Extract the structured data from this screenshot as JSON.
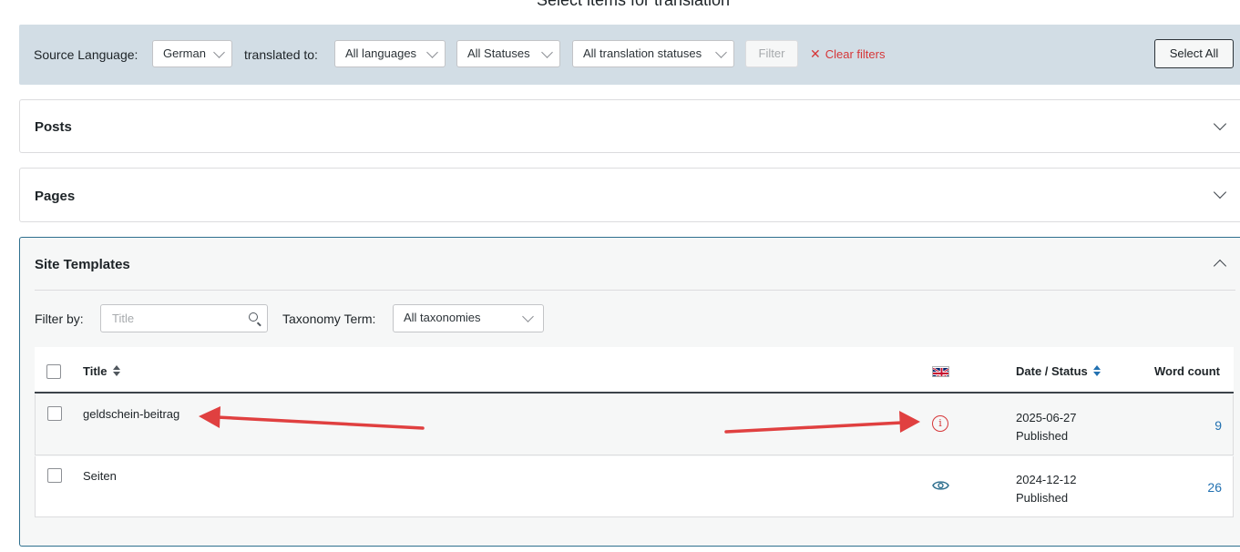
{
  "page": {
    "title": "Select items for translation"
  },
  "filter_bar": {
    "source_language_label": "Source Language:",
    "source_language_value": "German",
    "translated_to_label": "translated to:",
    "translated_to_value": "All languages",
    "status_value": "All Statuses",
    "translation_status_value": "All translation statuses",
    "filter_button": "Filter",
    "clear_filters": "Clear filters",
    "select_all": "Select All"
  },
  "panels": {
    "posts": "Posts",
    "pages": "Pages",
    "site_templates": "Site Templates"
  },
  "site_templates": {
    "filter_by_label": "Filter by:",
    "title_placeholder": "Title",
    "taxonomy_label": "Taxonomy Term:",
    "taxonomy_value": "All taxonomies",
    "columns": {
      "title": "Title",
      "date_status": "Date / Status",
      "word_count": "Word count"
    },
    "rows": [
      {
        "title": "geldschein-beitrag",
        "date": "2025-06-27",
        "status": "Published",
        "word_count": "9",
        "translation_icon": "info-icon"
      },
      {
        "title": "Seiten",
        "date": "2024-12-12",
        "status": "Published",
        "word_count": "26",
        "translation_icon": "eye-icon"
      }
    ]
  },
  "colors": {
    "filter_bar_bg": "#d2dde5",
    "accent_blue": "#2271b1",
    "warning_red": "#d63638",
    "annotation_arrow": "#e04040"
  }
}
